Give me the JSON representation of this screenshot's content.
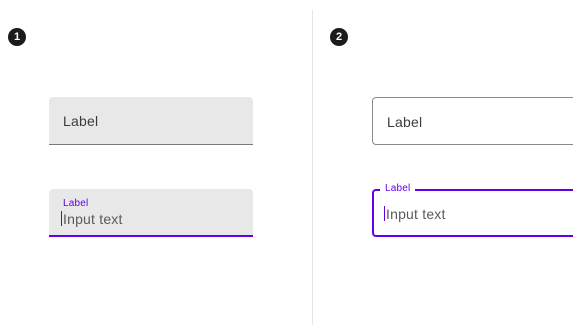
{
  "colors": {
    "accent": "#6200ee",
    "field_fill": "#e8e8e8",
    "badge": "#1b1b1b"
  },
  "section_1": {
    "badge": "1",
    "field_inactive": {
      "label": "Label"
    },
    "field_active": {
      "label": "Label",
      "value": "Input text"
    }
  },
  "section_2": {
    "badge": "2",
    "field_inactive": {
      "label": "Label"
    },
    "field_active": {
      "label": "Label",
      "value": "Input text"
    }
  }
}
